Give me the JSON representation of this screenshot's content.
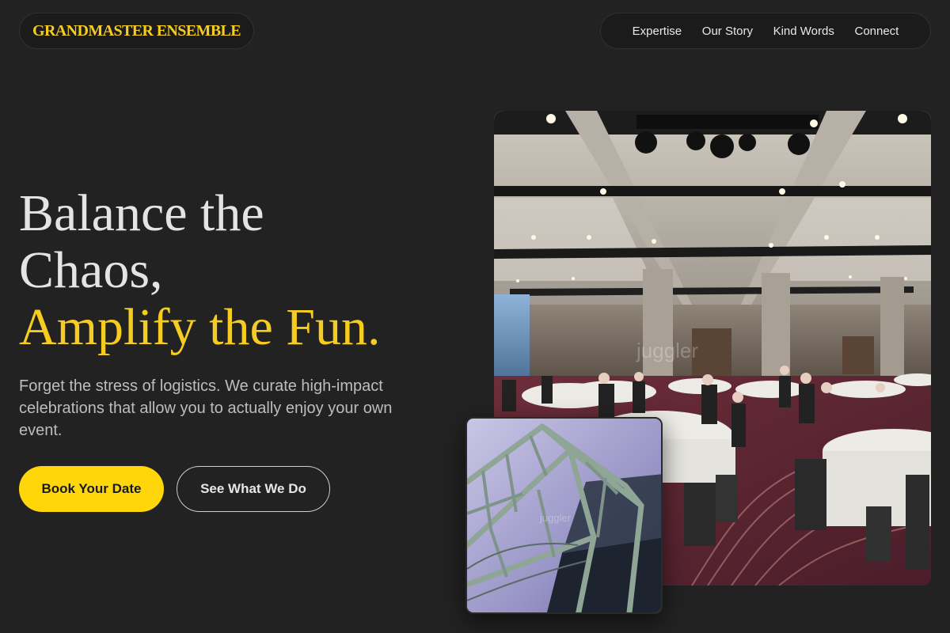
{
  "header": {
    "logo": "GRANDMASTER ENSEMBLE",
    "nav": [
      "Expertise",
      "Our Story",
      "Kind Words",
      "Connect"
    ]
  },
  "hero": {
    "title_line1": "Balance the",
    "title_line2": "Chaos,",
    "title_accent": "Amplify the Fun.",
    "description": "Forget the stress of logistics. We curate high-impact celebrations that allow you to actually enjoy your own event.",
    "primary_button": "Book Your Date",
    "secondary_button": "See What We Do"
  },
  "images": {
    "main_alt": "Ballroom banquet hall with round tables and guests",
    "inset_alt": "Steel truss rigging against a purple-lit ceiling"
  },
  "colors": {
    "background": "#222222",
    "accent": "#f5cc1f",
    "primary_button": "#ffd60a"
  }
}
